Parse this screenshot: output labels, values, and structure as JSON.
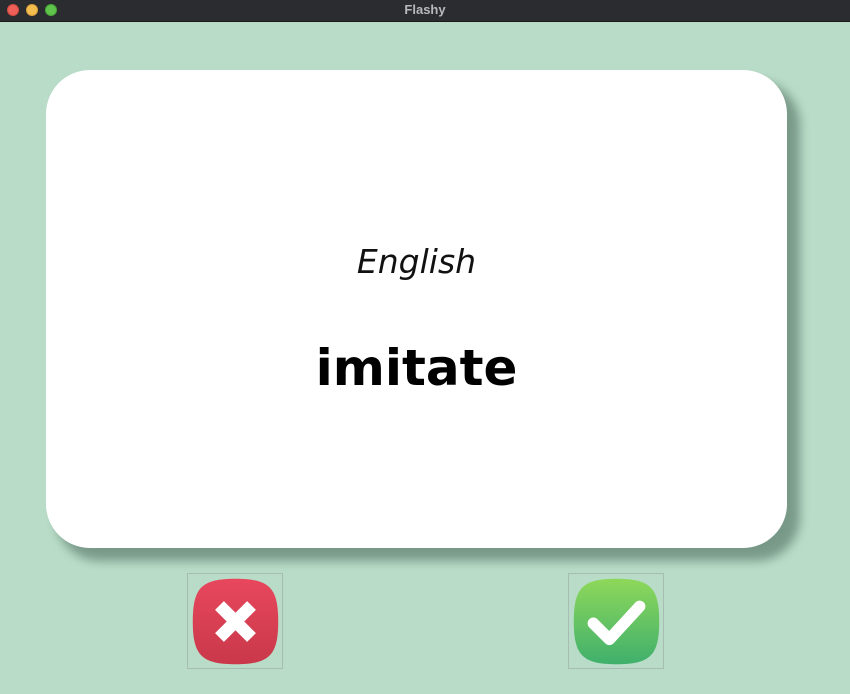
{
  "window": {
    "title": "Flashy"
  },
  "card": {
    "language": "English",
    "word": "imitate"
  },
  "buttons": {
    "wrong_icon": "cross-icon",
    "right_icon": "checkmark-icon"
  },
  "colors": {
    "background": "#b8dcc8",
    "card": "#ffffff",
    "wrong_button": "#e0425a",
    "right_button": "#5cc266"
  }
}
